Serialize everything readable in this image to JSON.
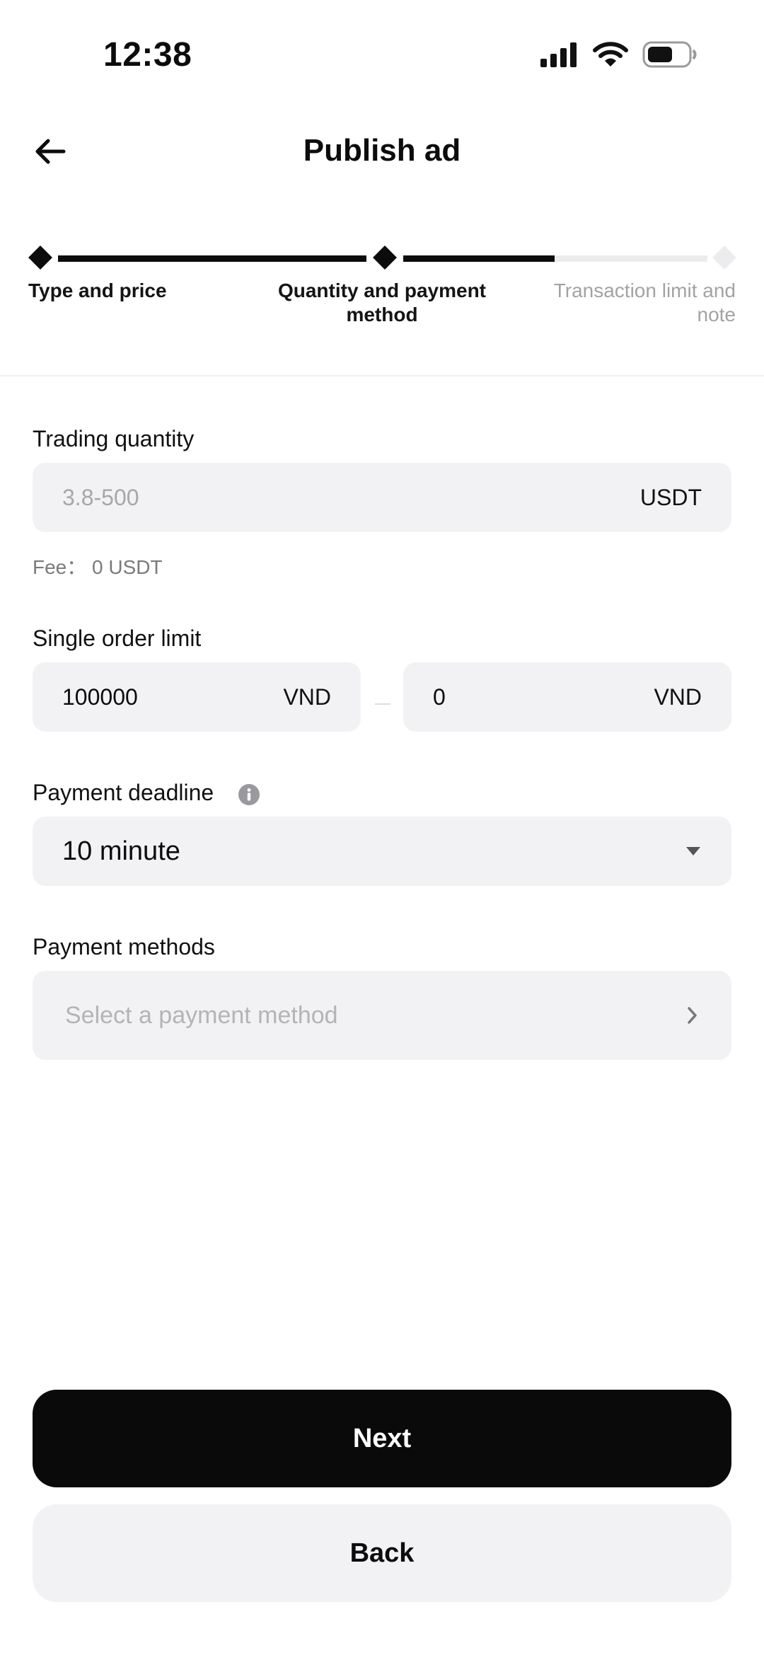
{
  "status_bar": {
    "time": "12:38"
  },
  "header": {
    "title": "Publish ad"
  },
  "stepper": {
    "steps": [
      {
        "label": "Type and price",
        "state": "done"
      },
      {
        "label": "Quantity and payment method",
        "state": "active"
      },
      {
        "label": "Transaction limit and note",
        "state": "pending"
      }
    ]
  },
  "form": {
    "trading_quantity": {
      "label": "Trading quantity",
      "placeholder": "3.8-500",
      "unit": "USDT"
    },
    "fee": {
      "text": "Fee：  0 USDT"
    },
    "single_order_limit": {
      "label": "Single order limit",
      "min_value": "100000",
      "min_unit": "VND",
      "max_value": "0",
      "max_unit": "VND"
    },
    "payment_deadline": {
      "label": "Payment deadline",
      "value": "10 minute"
    },
    "payment_methods": {
      "label": "Payment methods",
      "placeholder": "Select a payment method"
    }
  },
  "actions": {
    "next_label": "Next",
    "back_label": "Back"
  },
  "colors": {
    "primary": "#0a0a0a",
    "input_bg": "#f2f2f4",
    "muted": "#a7a7ab",
    "pending_step": "#e9e9ec"
  }
}
